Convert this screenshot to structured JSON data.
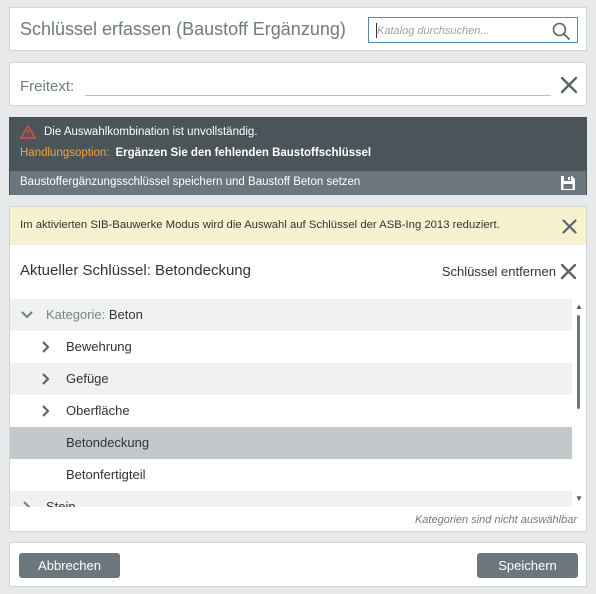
{
  "header": {
    "title": "Schlüssel erfassen (Baustoff Ergänzung)",
    "search_placeholder": "Katalog durchsuchen...",
    "search_icon": "search-icon"
  },
  "freitext": {
    "label": "Freitext:",
    "value": "",
    "clear_icon": "close-icon"
  },
  "warning": {
    "message": "Die Auswahlkombination ist unvollständig.",
    "option_label": "Handlungsoption:",
    "option_text": "Ergänzen Sie den fehlenden Baustoffschlüssel",
    "save_bar_text": "Baustoffergänzungsschlüssel speichern und Baustoff Beton setzen",
    "icons": {
      "warning": "warning-triangle-icon",
      "save": "floppy-disk-icon"
    },
    "colors": {
      "background": "#4b5458",
      "option": "#f0a43c",
      "bar": "#6b777c"
    }
  },
  "info": {
    "text": "Im aktivierten SIB-Bauwerke Modus wird die Auswahl auf Schlüssel der ASB-Ing 2013 reduziert.",
    "background": "#f7f1cf"
  },
  "current_key": {
    "label": "Aktueller Schlüssel: Betondeckung",
    "remove_label": "Schlüssel entfernen"
  },
  "tree": {
    "category_label": "Kategorie:",
    "category_value": "Beton",
    "items": [
      {
        "label": "Bewehrung",
        "expandable": true
      },
      {
        "label": "Gefüge",
        "expandable": true
      },
      {
        "label": "Oberfläche",
        "expandable": true
      },
      {
        "label": "Betondeckung",
        "expandable": false,
        "selected": true
      },
      {
        "label": "Betonfertigteil",
        "expandable": false
      }
    ],
    "next_category_partial": "Stein",
    "footnote": "Kategorien sind nicht auswählbar"
  },
  "footer": {
    "cancel_label": "Abbrechen",
    "save_label": "Speichern"
  }
}
